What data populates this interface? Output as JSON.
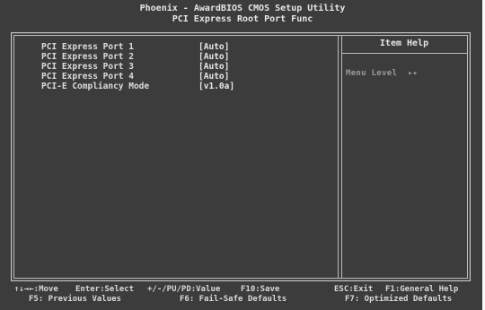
{
  "header": {
    "title": "Phoenix - AwardBIOS CMOS Setup Utility",
    "subtitle": "PCI Express Root Port Func"
  },
  "settings": [
    {
      "label": "PCI Express Port 1",
      "value": "[Auto]"
    },
    {
      "label": "PCI Express Port 2",
      "value": "[Auto]"
    },
    {
      "label": "PCI Express Port 3",
      "value": "[Auto]"
    },
    {
      "label": "PCI Express Port 4",
      "value": "[Auto]"
    },
    {
      "label": "PCI-E Compliancy Mode",
      "value": "[v1.0a]"
    }
  ],
  "help": {
    "title": "Item Help",
    "menu_level": "Menu Level",
    "menu_level_arrows": "▸▸"
  },
  "footer": {
    "row1": {
      "move": "↑↓→←:Move",
      "select": "Enter:Select",
      "value": "+/-/PU/PD:Value",
      "save": "F10:Save",
      "exit": "ESC:Exit",
      "general_help": "F1:General Help"
    },
    "row2": {
      "previous": "F5: Previous Values",
      "failsafe": "F6: Fail-Safe Defaults",
      "optimized": "F7: Optimized Defaults"
    }
  }
}
